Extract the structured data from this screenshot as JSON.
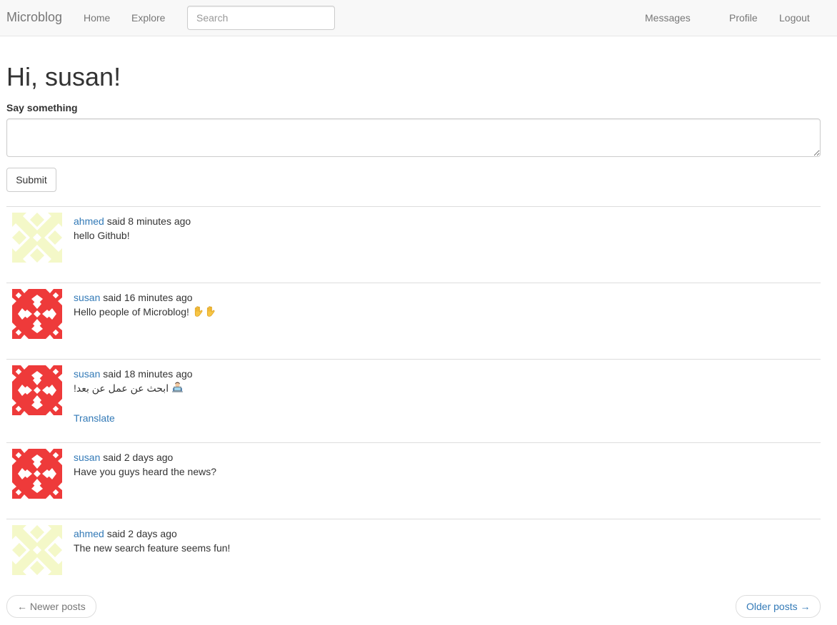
{
  "navbar": {
    "brand": "Microblog",
    "home": "Home",
    "explore": "Explore",
    "search_placeholder": "Search",
    "messages": "Messages",
    "profile": "Profile",
    "logout": "Logout"
  },
  "page": {
    "greeting": "Hi, susan!",
    "form_label": "Say something",
    "textarea_value": "",
    "submit_label": "Submit"
  },
  "posts": [
    {
      "author": "ahmed",
      "said": " said 8 minutes ago",
      "body": "hello Github!",
      "avatar_icon": "ahmed-identicon"
    },
    {
      "author": "susan",
      "said": " said 16 minutes ago",
      "body": "Hello people of Microblog! ",
      "emoji": "waving-hands-emoji",
      "avatar_icon": "susan-identicon"
    },
    {
      "author": "susan",
      "said": " said 18 minutes ago",
      "body": "ابحث عن عمل عن بعد!",
      "emoji": "technologist-emoji",
      "translate": "Translate",
      "avatar_icon": "susan-identicon"
    },
    {
      "author": "susan",
      "said": " said 2 days ago",
      "body": "Have you guys heard the news?",
      "avatar_icon": "susan-identicon"
    },
    {
      "author": "ahmed",
      "said": " said 2 days ago",
      "body": "The new search feature seems fun!",
      "avatar_icon": "ahmed-identicon"
    }
  ],
  "pager": {
    "newer": "← Newer posts",
    "older": "Older posts →"
  },
  "colors": {
    "link": "#337ab7",
    "nav_text": "#777777",
    "susan_avatar": "#ee3a3a",
    "ahmed_avatar": "#f4f8c8"
  }
}
